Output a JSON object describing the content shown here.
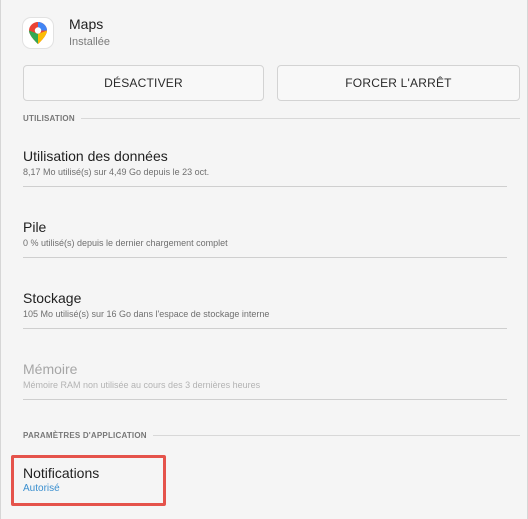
{
  "app": {
    "name": "Maps",
    "status": "Installée",
    "icon": "google-maps-pin-icon"
  },
  "buttons": {
    "disable_label": "DÉSACTIVER",
    "force_stop_label": "FORCER L'ARRÊT"
  },
  "sections": {
    "usage": "UTILISATION",
    "app_settings": "PARAMÈTRES D'APPLICATION"
  },
  "items": {
    "data": {
      "title": "Utilisation des données",
      "subtitle": "8,17 Mo utilisé(s) sur 4,49 Go depuis le 23 oct."
    },
    "battery": {
      "title": "Pile",
      "subtitle": "0 % utilisé(s) depuis le dernier chargement complet"
    },
    "storage": {
      "title": "Stockage",
      "subtitle": "105 Mo utilisé(s) sur 16 Go dans l'espace de stockage interne"
    },
    "memory": {
      "title": "Mémoire",
      "subtitle": "Mémoire RAM non utilisée au cours des 3 dernières heures"
    },
    "notifications": {
      "title": "Notifications",
      "subtitle": "Autorisé"
    }
  },
  "colors": {
    "highlight": "#e5534b",
    "link_blue": "#3a8fcf",
    "maps_red": "#ea4335",
    "maps_yellow": "#fbbc04",
    "maps_green": "#34a853",
    "maps_blue": "#4285f4"
  }
}
